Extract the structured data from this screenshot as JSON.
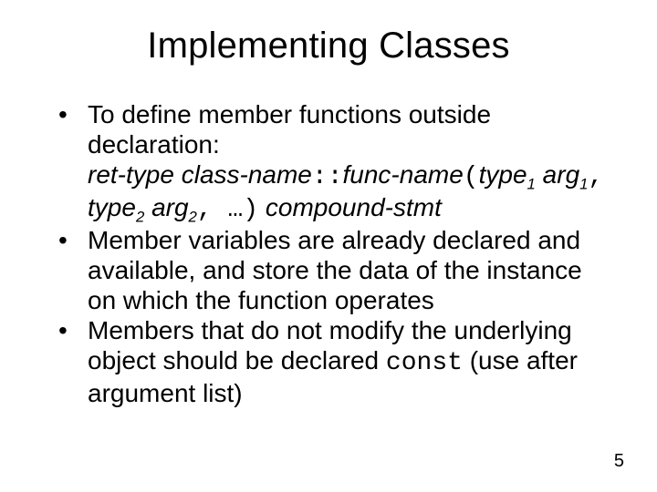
{
  "title": "Implementing Classes",
  "bullets": {
    "b1_line1": "To define member functions outside declaration:",
    "b1_syntax": {
      "ret_type": "ret-type",
      "class_name": "class-name",
      "scope": "::",
      "func_name": "func-name",
      "lparen": "(",
      "type": "type",
      "sub1": "1",
      "arg": "arg",
      "comma_sp": ", ",
      "sub2": "2",
      "ellipsis": ", …",
      "rparen": ")",
      "compound": "compound-stmt"
    },
    "b2": "Member variables are already declared and available, and store the data of the instance on which the function operates",
    "b3_part1": "Members that do not modify the underlying object should be declared ",
    "b3_const": "const",
    "b3_part2": " (use after argument list)"
  },
  "page_number": "5"
}
